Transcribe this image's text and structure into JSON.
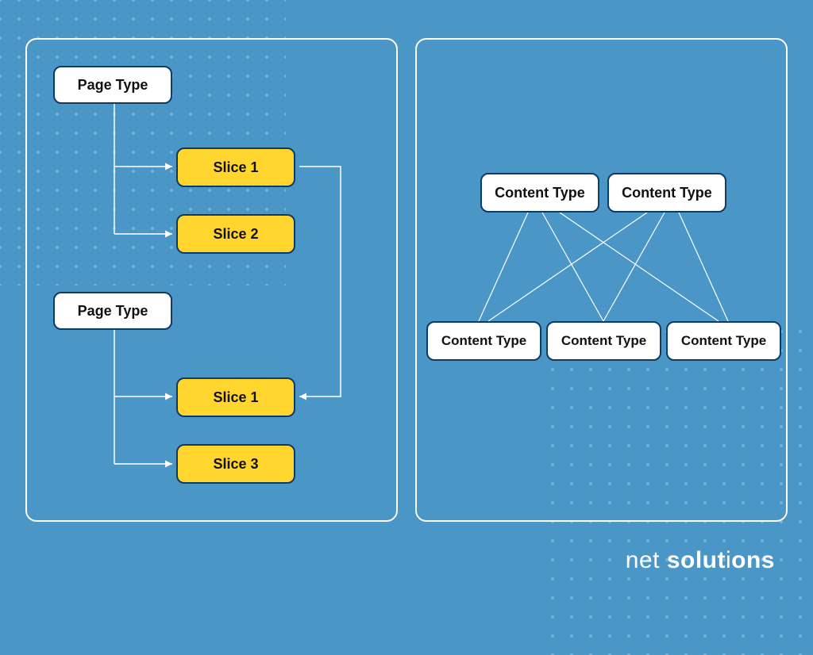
{
  "left_panel": {
    "page_type_1": "Page Type",
    "slice_1a": "Slice 1",
    "slice_2": "Slice 2",
    "page_type_2": "Page Type",
    "slice_1b": "Slice 1",
    "slice_3": "Slice 3"
  },
  "right_panel": {
    "top_a": "Content Type",
    "top_b": "Content Type",
    "bottom_a": "Content Type",
    "bottom_b": "Content Type",
    "bottom_c": "Content Type"
  },
  "brand": {
    "part1": "net ",
    "part2": "solut",
    "part3": "i",
    "part4": "ons"
  },
  "colors": {
    "background": "#4a96c7",
    "node_border": "#0e3a66",
    "white": "#ffffff",
    "yellow": "#ffd52e"
  }
}
